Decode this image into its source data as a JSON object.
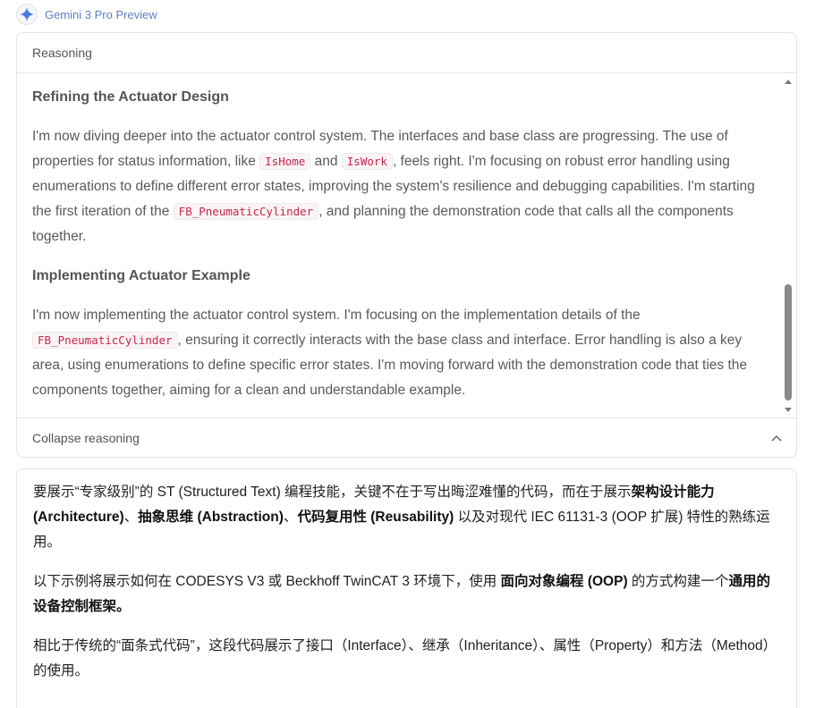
{
  "model": {
    "name": "Gemini 3 Pro Preview",
    "icon": "sparkle-icon",
    "accent": "#4a78e0"
  },
  "reasoning": {
    "header": "Reasoning",
    "sections": [
      {
        "title": "Refining the Actuator Design",
        "p_a": "I'm now diving deeper into the actuator control system. The interfaces and base class are progressing. The use of properties for status information, like ",
        "code_1": "IsHome",
        "p_b": " and ",
        "code_2": "IsWork",
        "p_c": ", feels right. I'm focusing on robust error handling using enumerations to define different error states, improving the system's resilience and debugging capabilities. I'm starting the first iteration of the ",
        "code_3": "FB_PneumaticCylinder",
        "p_d": ", and planning the demonstration code that calls all the components together."
      },
      {
        "title": "Implementing Actuator Example",
        "p_a": "I'm now implementing the actuator control system. I'm focusing on the implementation details of the ",
        "code_1": "FB_PneumaticCylinder",
        "p_b": ", ensuring it correctly interacts with the base class and interface. Error handling is also a key area, using enumerations to define specific error states. I'm moving forward with the demonstration code that ties the components together, aiming for a clean and understandable example."
      }
    ],
    "collapse_label": "Collapse reasoning"
  },
  "answer": {
    "p1": {
      "t1": "要展示“专家级别”的 ST (Structured Text) 编程技能，关键不在于写出晦涩难懂的代码，而在于展示",
      "b1": "架构设计能力 (Architecture)",
      "t2": "、",
      "b2": "抽象思维 (Abstraction)",
      "t3": "、",
      "b3": "代码复用性 (Reusability)",
      "t4": " 以及对现代 IEC 61131-3 (OOP 扩展) 特性的熟练运用。"
    },
    "p2": {
      "t1": "以下示例将展示如何在 CODESYS V3 或 Beckhoff TwinCAT 3 环境下，使用 ",
      "b1": "面向对象编程 (OOP)",
      "t2": " 的方式构建一个",
      "b2": "通用的设备控制框架。"
    },
    "p3": "相比于传统的“面条式代码”，这段代码展示了接口（Interface）、继承（Inheritance）、属性（Property）和方法（Method）的使用。"
  }
}
